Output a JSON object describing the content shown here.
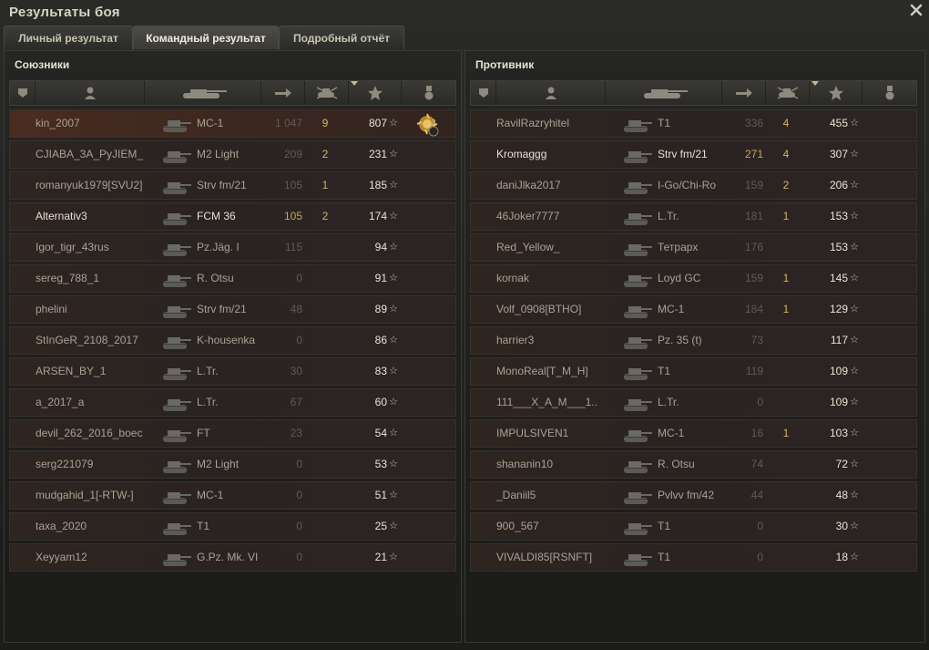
{
  "window": {
    "title": "Результаты боя"
  },
  "tabs": [
    {
      "label": "Личный результат",
      "active": false
    },
    {
      "label": "Командный результат",
      "active": true
    },
    {
      "label": "Подробный отчёт",
      "active": false
    }
  ],
  "icons": {
    "close": "close-icon",
    "platoon": "platoon-icon",
    "player": "player-icon",
    "tank": "tank-icon",
    "damage": "damage-icon",
    "kills": "kills-icon",
    "xp": "xp-star-icon",
    "medal": "medal-icon",
    "sort": "sort-indicator-icon"
  },
  "colors": {
    "highlight_row": "#4a2c1f",
    "kills": "#d4b460",
    "damage_highlight": "#c9a65e"
  },
  "allies": {
    "title": "Союзники",
    "rows": [
      {
        "player": "kin_2007",
        "tank": "МС-1",
        "damage": "1 047",
        "kills": "9",
        "xp": "807",
        "star": "☆",
        "medal": "3",
        "highlight": true
      },
      {
        "player": "CJIABA_3A_PyJIEM_",
        "tank": "M2 Light",
        "damage": "209",
        "kills": "2",
        "xp": "231",
        "star": "☆"
      },
      {
        "player": "romanyuk1979[SVU2]",
        "tank": "Strv fm/21",
        "damage": "105",
        "kills": "1",
        "xp": "185",
        "star": "☆"
      },
      {
        "player": "Alternativ3",
        "tank": "FCM 36",
        "damage": "105",
        "kills": "2",
        "xp": "174",
        "star": "☆",
        "white": true,
        "dmgBright": true
      },
      {
        "player": "Igor_tigr_43rus",
        "tank": "Pz.Jäg. I",
        "damage": "115",
        "kills": "",
        "xp": "94",
        "star": "☆"
      },
      {
        "player": "sereg_788_1",
        "tank": "R. Otsu",
        "damage": "0",
        "kills": "",
        "xp": "91",
        "star": "☆"
      },
      {
        "player": "phelini",
        "tank": "Strv fm/21",
        "damage": "48",
        "kills": "",
        "xp": "89",
        "star": "☆"
      },
      {
        "player": "StInGeR_2108_2017",
        "tank": "K-housenka",
        "damage": "0",
        "kills": "",
        "xp": "86",
        "star": "☆"
      },
      {
        "player": "ARSEN_BY_1",
        "tank": "L.Tr.",
        "damage": "30",
        "kills": "",
        "xp": "83",
        "star": "☆"
      },
      {
        "player": "a_2017_a",
        "tank": "L.Tr.",
        "damage": "67",
        "kills": "",
        "xp": "60",
        "star": "☆"
      },
      {
        "player": "devil_262_2016_boec",
        "tank": "FT",
        "damage": "23",
        "kills": "",
        "xp": "54",
        "star": "☆"
      },
      {
        "player": "serg221079",
        "tank": "M2 Light",
        "damage": "0",
        "kills": "",
        "xp": "53",
        "star": "☆"
      },
      {
        "player": "mudgahid_1[-RTW-]",
        "tank": "МС-1",
        "damage": "0",
        "kills": "",
        "xp": "51",
        "star": "☆"
      },
      {
        "player": "taxa_2020",
        "tank": "T1",
        "damage": "0",
        "kills": "",
        "xp": "25",
        "star": "☆"
      },
      {
        "player": "Xeyyam12",
        "tank": "G.Pz. Mk. VI",
        "damage": "0",
        "kills": "",
        "xp": "21",
        "star": "☆"
      }
    ]
  },
  "enemies": {
    "title": "Противник",
    "rows": [
      {
        "player": "RavilRazryhitel",
        "tank": "T1",
        "damage": "336",
        "kills": "4",
        "xp": "455",
        "star": "☆"
      },
      {
        "player": "Kromaggg",
        "tank": "Strv fm/21",
        "damage": "271",
        "kills": "4",
        "xp": "307",
        "star": "☆",
        "white": true,
        "dmgBright": true
      },
      {
        "player": "daniJlka2017",
        "tank": "I-Go/Chi-Ro",
        "damage": "159",
        "kills": "2",
        "xp": "206",
        "star": "☆"
      },
      {
        "player": "46Joker7777",
        "tank": "L.Tr.",
        "damage": "181",
        "kills": "1",
        "xp": "153",
        "star": "☆"
      },
      {
        "player": "Red_Yellow_",
        "tank": "Тетрарх",
        "damage": "176",
        "kills": "",
        "xp": "153",
        "star": "☆"
      },
      {
        "player": "kornak",
        "tank": "Loyd GC",
        "damage": "159",
        "kills": "1",
        "xp": "145",
        "star": "☆"
      },
      {
        "player": "Volf_0908[BTHO]",
        "tank": "МС-1",
        "damage": "184",
        "kills": "1",
        "xp": "129",
        "star": "☆"
      },
      {
        "player": "harrier3",
        "tank": "Pz. 35 (t)",
        "damage": "73",
        "kills": "",
        "xp": "117",
        "star": "☆"
      },
      {
        "player": "MonoReal[T_M_H]",
        "tank": "T1",
        "damage": "119",
        "kills": "",
        "xp": "109",
        "star": "☆"
      },
      {
        "player": "111___X_A_M___1..",
        "tank": "L.Tr.",
        "damage": "0",
        "kills": "",
        "xp": "109",
        "star": "☆"
      },
      {
        "player": "IMPULSIVEN1",
        "tank": "МС-1",
        "damage": "16",
        "kills": "1",
        "xp": "103",
        "star": "☆"
      },
      {
        "player": "shananin10",
        "tank": "R. Otsu",
        "damage": "74",
        "kills": "",
        "xp": "72",
        "star": "☆"
      },
      {
        "player": "_Daniil5",
        "tank": "Pvlvv fm/42",
        "damage": "44",
        "kills": "",
        "xp": "48",
        "star": "☆"
      },
      {
        "player": "900_567",
        "tank": "T1",
        "damage": "0",
        "kills": "",
        "xp": "30",
        "star": "☆"
      },
      {
        "player": "VIVALDI85[RSNFT]",
        "tank": "T1",
        "damage": "0",
        "kills": "",
        "xp": "18",
        "star": "☆"
      }
    ]
  }
}
